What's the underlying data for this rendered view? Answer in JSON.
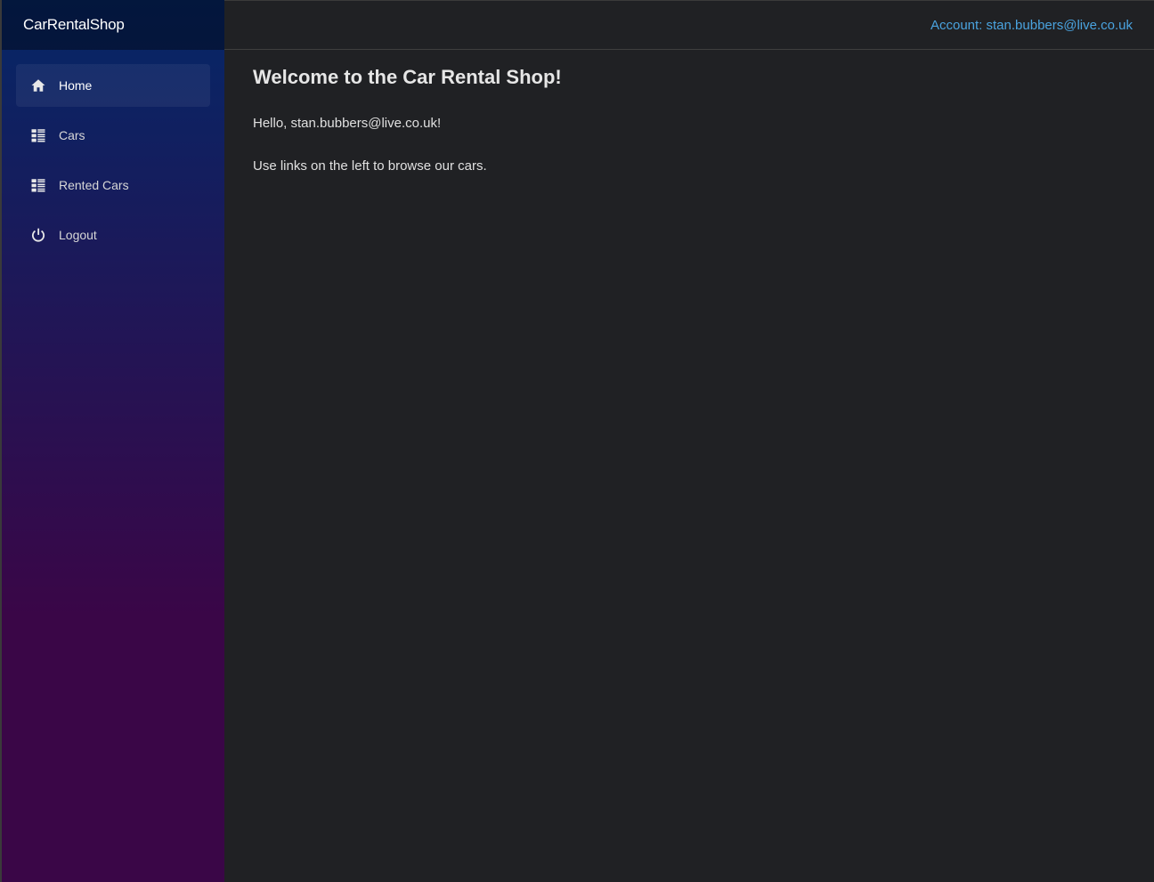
{
  "brand": "CarRentalShop",
  "account_link": "Account: stan.bubbers@live.co.uk",
  "nav": [
    {
      "label": "Home",
      "icon": "home-icon",
      "active": true
    },
    {
      "label": "Cars",
      "icon": "list-icon"
    },
    {
      "label": "Rented Cars",
      "icon": "list-icon"
    },
    {
      "label": "Logout",
      "icon": "power-icon"
    }
  ],
  "main": {
    "title": "Welcome to the Car Rental Shop!",
    "greeting": "Hello, stan.bubbers@live.co.uk!",
    "instruction": "Use links on the left to browse our cars."
  },
  "colors": {
    "sidebar_top": "#052767",
    "sidebar_bottom": "#3a0647",
    "background": "#202124",
    "link": "#4aa3df"
  }
}
